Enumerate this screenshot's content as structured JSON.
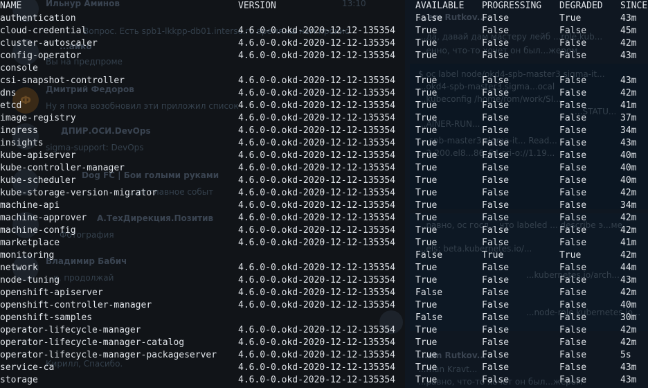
{
  "background": {
    "chat_messages": [
      {
        "name": "Ильнур Аминов",
        "text": "Вопрос. Есть spb1-lkkpp-db01.interso.ru время на нем прокис",
        "time": "13:10"
      },
      {
        "name": "...айко",
        "text": "Вы на предпроме"
      },
      {
        "name": "Дмитрий Федоров",
        "text": "Ну я пока возобновил эти приложил список"
      },
      {
        "name": "ДПИР.ОСИ.DevOps",
        "text": "sigma-support: DevOps"
      },
      {
        "name": "Dog FC | Бои голыми руками",
        "text": "...ет главное событ"
      },
      {
        "name": "А.ТехДирекция.Позитив",
        "text": "Фотография"
      },
      {
        "name": "Владимир Бабич",
        "text": "...к, продолжай"
      },
      {
        "name": "",
        "text": "Кирилл, Спасибо."
      }
    ],
    "right_fragments": [
      "...em Rutkov...",
      "...да, давай дам мастеру лейб ...role.kub...",
      "...енно, что-то хочет он был...жером",
      "$ oc label node/okd4-spb-master3.sigma-it...",
      "...okd4-spb-master3.sigma...ocal",
      "...kubeconfig /home/rom/work/SI...",
      "...STATU...",
      "...AINER-RUN...",
      "...-spb-master3.sigma-it...  Read...",
      "...2-200.el8...86_64  cri-o://1.19...",
      "...равно, ос госл... что labeled ... describe э...ме",
      "...els:  beta.kubernetes.io/...",
      "...kubernetes.io/arch...",
      "...node-role.kubernetes.io...",
      "...em Rutkov...",
      "...man Kravt...",
      "...равно, что-то хочет он был...жером"
    ]
  },
  "table": {
    "headers": [
      "NAME",
      "VERSION",
      "AVAILABLE",
      "PROGRESSING",
      "DEGRADED",
      "SINCE"
    ],
    "rows": [
      [
        "authentication",
        "",
        "False",
        "False",
        "True",
        "43m"
      ],
      [
        "cloud-credential",
        "4.6.0-0.okd-2020-12-12-135354",
        "True",
        "False",
        "False",
        "45m"
      ],
      [
        "cluster-autoscaler",
        "4.6.0-0.okd-2020-12-12-135354",
        "True",
        "False",
        "False",
        "42m"
      ],
      [
        "config-operator",
        "4.6.0-0.okd-2020-12-12-135354",
        "True",
        "False",
        "False",
        "43m"
      ],
      [
        "console",
        "",
        "",
        "",
        "",
        ""
      ],
      [
        "csi-snapshot-controller",
        "4.6.0-0.okd-2020-12-12-135354",
        "True",
        "False",
        "False",
        "43m"
      ],
      [
        "dns",
        "4.6.0-0.okd-2020-12-12-135354",
        "True",
        "False",
        "False",
        "42m"
      ],
      [
        "etcd",
        "4.6.0-0.okd-2020-12-12-135354",
        "True",
        "False",
        "False",
        "41m"
      ],
      [
        "image-registry",
        "4.6.0-0.okd-2020-12-12-135354",
        "True",
        "False",
        "False",
        "37m"
      ],
      [
        "ingress",
        "4.6.0-0.okd-2020-12-12-135354",
        "True",
        "False",
        "False",
        "34m"
      ],
      [
        "insights",
        "4.6.0-0.okd-2020-12-12-135354",
        "True",
        "False",
        "False",
        "43m"
      ],
      [
        "kube-apiserver",
        "4.6.0-0.okd-2020-12-12-135354",
        "True",
        "False",
        "False",
        "40m"
      ],
      [
        "kube-controller-manager",
        "4.6.0-0.okd-2020-12-12-135354",
        "True",
        "False",
        "False",
        "40m"
      ],
      [
        "kube-scheduler",
        "4.6.0-0.okd-2020-12-12-135354",
        "True",
        "False",
        "False",
        "40m"
      ],
      [
        "kube-storage-version-migrator",
        "4.6.0-0.okd-2020-12-12-135354",
        "True",
        "False",
        "False",
        "42m"
      ],
      [
        "machine-api",
        "4.6.0-0.okd-2020-12-12-135354",
        "True",
        "False",
        "False",
        "34m"
      ],
      [
        "machine-approver",
        "4.6.0-0.okd-2020-12-12-135354",
        "True",
        "False",
        "False",
        "42m"
      ],
      [
        "machine-config",
        "4.6.0-0.okd-2020-12-12-135354",
        "True",
        "False",
        "False",
        "42m"
      ],
      [
        "marketplace",
        "4.6.0-0.okd-2020-12-12-135354",
        "True",
        "False",
        "False",
        "41m"
      ],
      [
        "monitoring",
        "",
        "False",
        "True",
        "True",
        "42m"
      ],
      [
        "network",
        "4.6.0-0.okd-2020-12-12-135354",
        "True",
        "False",
        "False",
        "44m"
      ],
      [
        "node-tuning",
        "4.6.0-0.okd-2020-12-12-135354",
        "True",
        "False",
        "False",
        "43m"
      ],
      [
        "openshift-apiserver",
        "4.6.0-0.okd-2020-12-12-135354",
        "False",
        "False",
        "False",
        "42m"
      ],
      [
        "openshift-controller-manager",
        "4.6.0-0.okd-2020-12-12-135354",
        "True",
        "False",
        "False",
        "40m"
      ],
      [
        "openshift-samples",
        "",
        "False",
        "False",
        "False",
        "30m"
      ],
      [
        "operator-lifecycle-manager",
        "4.6.0-0.okd-2020-12-12-135354",
        "True",
        "False",
        "False",
        "42m"
      ],
      [
        "operator-lifecycle-manager-catalog",
        "4.6.0-0.okd-2020-12-12-135354",
        "True",
        "False",
        "False",
        "42m"
      ],
      [
        "operator-lifecycle-manager-packageserver",
        "4.6.0-0.okd-2020-12-12-135354",
        "True",
        "False",
        "False",
        "5s"
      ],
      [
        "service-ca",
        "4.6.0-0.okd-2020-12-12-135354",
        "True",
        "False",
        "False",
        "43m"
      ],
      [
        "storage",
        "4.6.0-0.okd-2020-12-12-135354",
        "True",
        "False",
        "False",
        "43m"
      ]
    ]
  }
}
